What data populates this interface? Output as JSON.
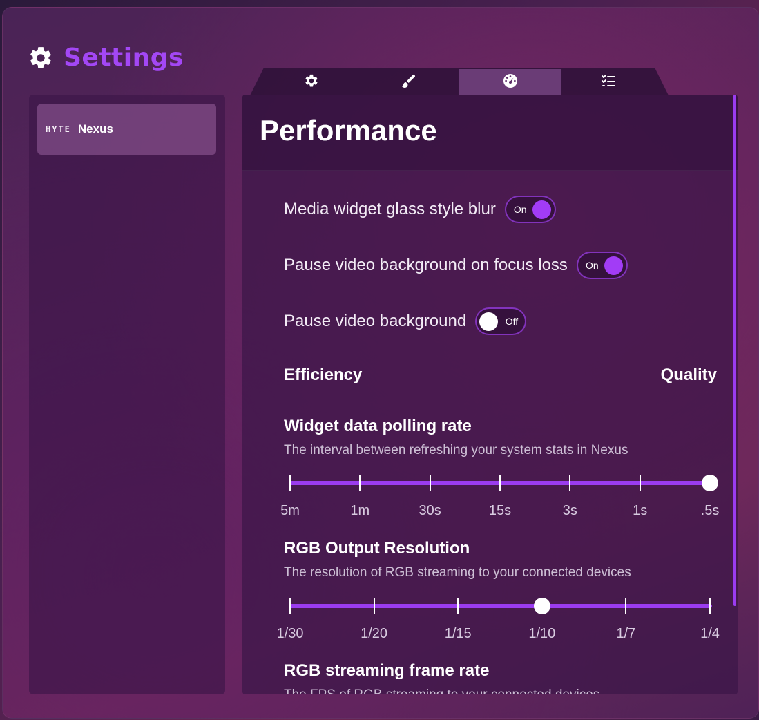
{
  "app": {
    "title": "Settings"
  },
  "sidebar": {
    "items": [
      {
        "logo": "HYTE",
        "label": "Nexus"
      }
    ]
  },
  "tabs": [
    {
      "icon": "gear-icon",
      "active": false
    },
    {
      "icon": "brush-icon",
      "active": false
    },
    {
      "icon": "gauge-icon",
      "active": true
    },
    {
      "icon": "checklist-icon",
      "active": false
    }
  ],
  "panel": {
    "title": "Performance",
    "toggles": [
      {
        "label": "Media widget glass style blur",
        "state": "On"
      },
      {
        "label": "Pause video background on focus loss",
        "state": "On"
      },
      {
        "label": "Pause video background",
        "state": "Off"
      }
    ],
    "scale": {
      "left": "Efficiency",
      "right": "Quality"
    },
    "polling": {
      "title": "Widget data polling rate",
      "description": "The interval between refreshing your system stats in Nexus",
      "ticks": [
        "5m",
        "1m",
        "30s",
        "15s",
        "3s",
        "1s",
        ".5s"
      ],
      "selected": ".5s"
    },
    "rgb_resolution": {
      "title": "RGB Output Resolution",
      "description": "The resolution of RGB streaming to your connected devices",
      "ticks": [
        "1/30",
        "1/20",
        "1/15",
        "1/10",
        "1/7",
        "1/4"
      ],
      "selected": "1/10"
    },
    "rgb_framerate": {
      "title": "RGB streaming frame rate",
      "description": "The FPS of RGB streaming to your connected devices"
    }
  },
  "colors": {
    "accent": "#a347f5",
    "track": "#9b3cf0"
  }
}
